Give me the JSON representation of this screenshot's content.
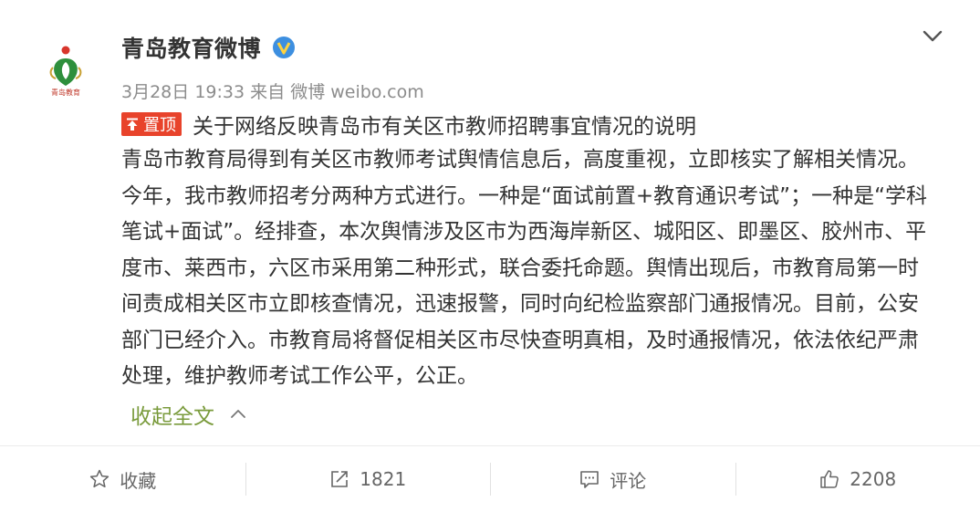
{
  "account": {
    "name": "青岛教育微博",
    "avatar_caption": "青岛教育",
    "verified": true
  },
  "meta": {
    "date": "3月28日",
    "time": "19:33",
    "source_prefix": "来自",
    "source": "微博 weibo.com"
  },
  "post": {
    "pin_label": "置顶",
    "title": "关于网络反映青岛市有关区市教师招聘事宜情况的说明",
    "body": "青岛市教育局得到有关区市教师考试舆情信息后，高度重视，立即核实了解相关情况。今年，我市教师招考分两种方式进行。一种是“面试前置+教育通识考试”；一种是“学科笔试+面试”。经排查，本次舆情涉及区市为西海岸新区、城阳区、即墨区、胶州市、平度市、莱西市，六区市采用第二种形式，联合委托命题。舆情出现后，市教育局第一时间责成相关区市立即核查情况，迅速报警，同时向纪检监察部门通报情况。目前，公安部门已经介入。市教育局将督促相关区市尽快查明真相，及时通报情况，依法依纪严肃处理，维护教师考试工作公平，公正。",
    "collapse_label": "收起全文"
  },
  "actions": {
    "favorite_label": "收藏",
    "repost_count": "1821",
    "comment_label": "评论",
    "like_count": "2208"
  },
  "colors": {
    "pin_red": "#e8432b",
    "link_green": "#7a9b3c",
    "verified_blue": "#3d8fe0"
  }
}
